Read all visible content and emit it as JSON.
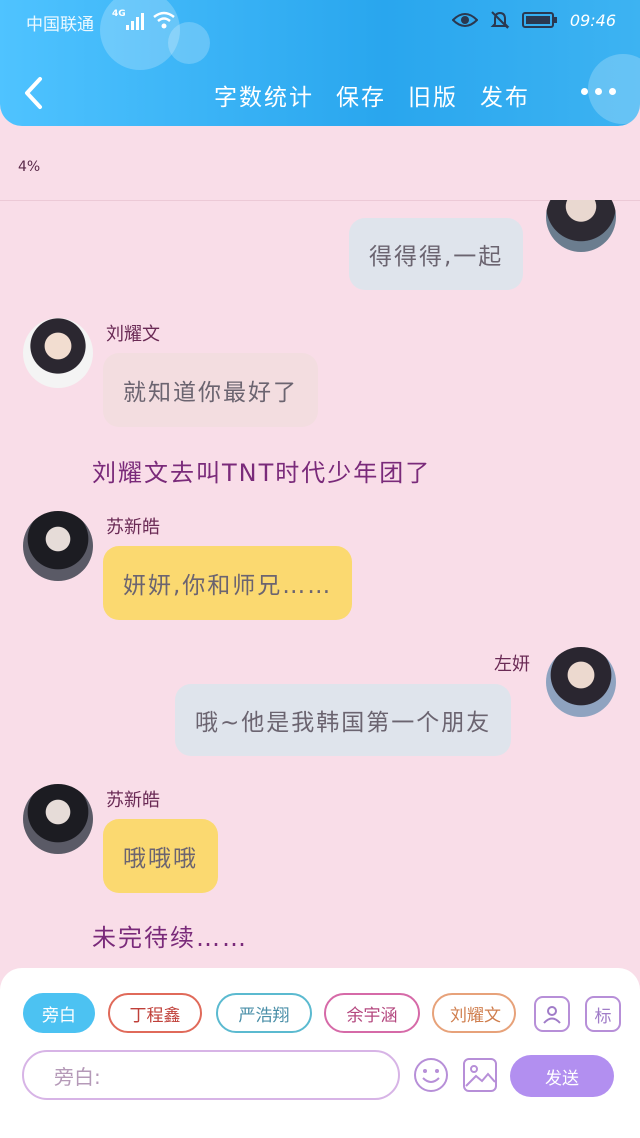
{
  "status_bar": {
    "carrier": "中国联通",
    "network": "4G",
    "time": "09:46"
  },
  "toolbar": {
    "word_count": "字数统计",
    "save": "保存",
    "old_version": "旧版",
    "publish": "发布"
  },
  "progress": {
    "text": "4%",
    "value": 0.04
  },
  "messages": [
    {
      "speaker": "",
      "side": "right",
      "text": "得得得,一起"
    },
    {
      "speaker": "刘耀文",
      "side": "left",
      "text": "就知道你最好了"
    },
    {
      "type": "narration",
      "text": "刘耀文去叫TNT时代少年团了"
    },
    {
      "speaker": "苏新皓",
      "side": "left",
      "text": "妍妍,你和师兄……"
    },
    {
      "speaker": "左妍",
      "side": "right",
      "text": "哦~他是我韩国第一个朋友"
    },
    {
      "speaker": "苏新皓",
      "side": "left",
      "text": "哦哦哦"
    },
    {
      "type": "narration",
      "text": "未完待续……"
    }
  ],
  "role_chips": [
    "旁白",
    "丁程鑫",
    "严浩翔",
    "余宇涵",
    "刘耀文"
  ],
  "composer": {
    "placeholder": "旁白:",
    "send_label": "发送",
    "tag_label": "标"
  },
  "colors": {
    "header": "#29a6ee",
    "background": "#f9dde8",
    "bubble_blue": "#dfe4ec",
    "bubble_pink": "#f3dde0",
    "bubble_yellow": "#fbd970",
    "send": "#b28ff0"
  }
}
